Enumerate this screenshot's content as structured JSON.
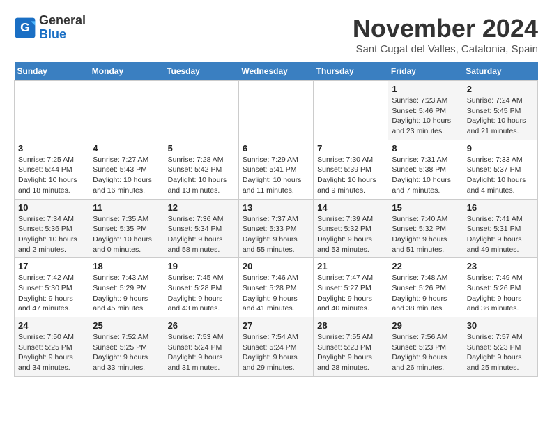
{
  "header": {
    "logo_line1": "General",
    "logo_line2": "Blue",
    "month_year": "November 2024",
    "location": "Sant Cugat del Valles, Catalonia, Spain"
  },
  "weekdays": [
    "Sunday",
    "Monday",
    "Tuesday",
    "Wednesday",
    "Thursday",
    "Friday",
    "Saturday"
  ],
  "weeks": [
    [
      {
        "day": "",
        "info": ""
      },
      {
        "day": "",
        "info": ""
      },
      {
        "day": "",
        "info": ""
      },
      {
        "day": "",
        "info": ""
      },
      {
        "day": "",
        "info": ""
      },
      {
        "day": "1",
        "info": "Sunrise: 7:23 AM\nSunset: 5:46 PM\nDaylight: 10 hours and 23 minutes."
      },
      {
        "day": "2",
        "info": "Sunrise: 7:24 AM\nSunset: 5:45 PM\nDaylight: 10 hours and 21 minutes."
      }
    ],
    [
      {
        "day": "3",
        "info": "Sunrise: 7:25 AM\nSunset: 5:44 PM\nDaylight: 10 hours and 18 minutes."
      },
      {
        "day": "4",
        "info": "Sunrise: 7:27 AM\nSunset: 5:43 PM\nDaylight: 10 hours and 16 minutes."
      },
      {
        "day": "5",
        "info": "Sunrise: 7:28 AM\nSunset: 5:42 PM\nDaylight: 10 hours and 13 minutes."
      },
      {
        "day": "6",
        "info": "Sunrise: 7:29 AM\nSunset: 5:41 PM\nDaylight: 10 hours and 11 minutes."
      },
      {
        "day": "7",
        "info": "Sunrise: 7:30 AM\nSunset: 5:39 PM\nDaylight: 10 hours and 9 minutes."
      },
      {
        "day": "8",
        "info": "Sunrise: 7:31 AM\nSunset: 5:38 PM\nDaylight: 10 hours and 7 minutes."
      },
      {
        "day": "9",
        "info": "Sunrise: 7:33 AM\nSunset: 5:37 PM\nDaylight: 10 hours and 4 minutes."
      }
    ],
    [
      {
        "day": "10",
        "info": "Sunrise: 7:34 AM\nSunset: 5:36 PM\nDaylight: 10 hours and 2 minutes."
      },
      {
        "day": "11",
        "info": "Sunrise: 7:35 AM\nSunset: 5:35 PM\nDaylight: 10 hours and 0 minutes."
      },
      {
        "day": "12",
        "info": "Sunrise: 7:36 AM\nSunset: 5:34 PM\nDaylight: 9 hours and 58 minutes."
      },
      {
        "day": "13",
        "info": "Sunrise: 7:37 AM\nSunset: 5:33 PM\nDaylight: 9 hours and 55 minutes."
      },
      {
        "day": "14",
        "info": "Sunrise: 7:39 AM\nSunset: 5:32 PM\nDaylight: 9 hours and 53 minutes."
      },
      {
        "day": "15",
        "info": "Sunrise: 7:40 AM\nSunset: 5:32 PM\nDaylight: 9 hours and 51 minutes."
      },
      {
        "day": "16",
        "info": "Sunrise: 7:41 AM\nSunset: 5:31 PM\nDaylight: 9 hours and 49 minutes."
      }
    ],
    [
      {
        "day": "17",
        "info": "Sunrise: 7:42 AM\nSunset: 5:30 PM\nDaylight: 9 hours and 47 minutes."
      },
      {
        "day": "18",
        "info": "Sunrise: 7:43 AM\nSunset: 5:29 PM\nDaylight: 9 hours and 45 minutes."
      },
      {
        "day": "19",
        "info": "Sunrise: 7:45 AM\nSunset: 5:28 PM\nDaylight: 9 hours and 43 minutes."
      },
      {
        "day": "20",
        "info": "Sunrise: 7:46 AM\nSunset: 5:28 PM\nDaylight: 9 hours and 41 minutes."
      },
      {
        "day": "21",
        "info": "Sunrise: 7:47 AM\nSunset: 5:27 PM\nDaylight: 9 hours and 40 minutes."
      },
      {
        "day": "22",
        "info": "Sunrise: 7:48 AM\nSunset: 5:26 PM\nDaylight: 9 hours and 38 minutes."
      },
      {
        "day": "23",
        "info": "Sunrise: 7:49 AM\nSunset: 5:26 PM\nDaylight: 9 hours and 36 minutes."
      }
    ],
    [
      {
        "day": "24",
        "info": "Sunrise: 7:50 AM\nSunset: 5:25 PM\nDaylight: 9 hours and 34 minutes."
      },
      {
        "day": "25",
        "info": "Sunrise: 7:52 AM\nSunset: 5:25 PM\nDaylight: 9 hours and 33 minutes."
      },
      {
        "day": "26",
        "info": "Sunrise: 7:53 AM\nSunset: 5:24 PM\nDaylight: 9 hours and 31 minutes."
      },
      {
        "day": "27",
        "info": "Sunrise: 7:54 AM\nSunset: 5:24 PM\nDaylight: 9 hours and 29 minutes."
      },
      {
        "day": "28",
        "info": "Sunrise: 7:55 AM\nSunset: 5:23 PM\nDaylight: 9 hours and 28 minutes."
      },
      {
        "day": "29",
        "info": "Sunrise: 7:56 AM\nSunset: 5:23 PM\nDaylight: 9 hours and 26 minutes."
      },
      {
        "day": "30",
        "info": "Sunrise: 7:57 AM\nSunset: 5:23 PM\nDaylight: 9 hours and 25 minutes."
      }
    ]
  ]
}
